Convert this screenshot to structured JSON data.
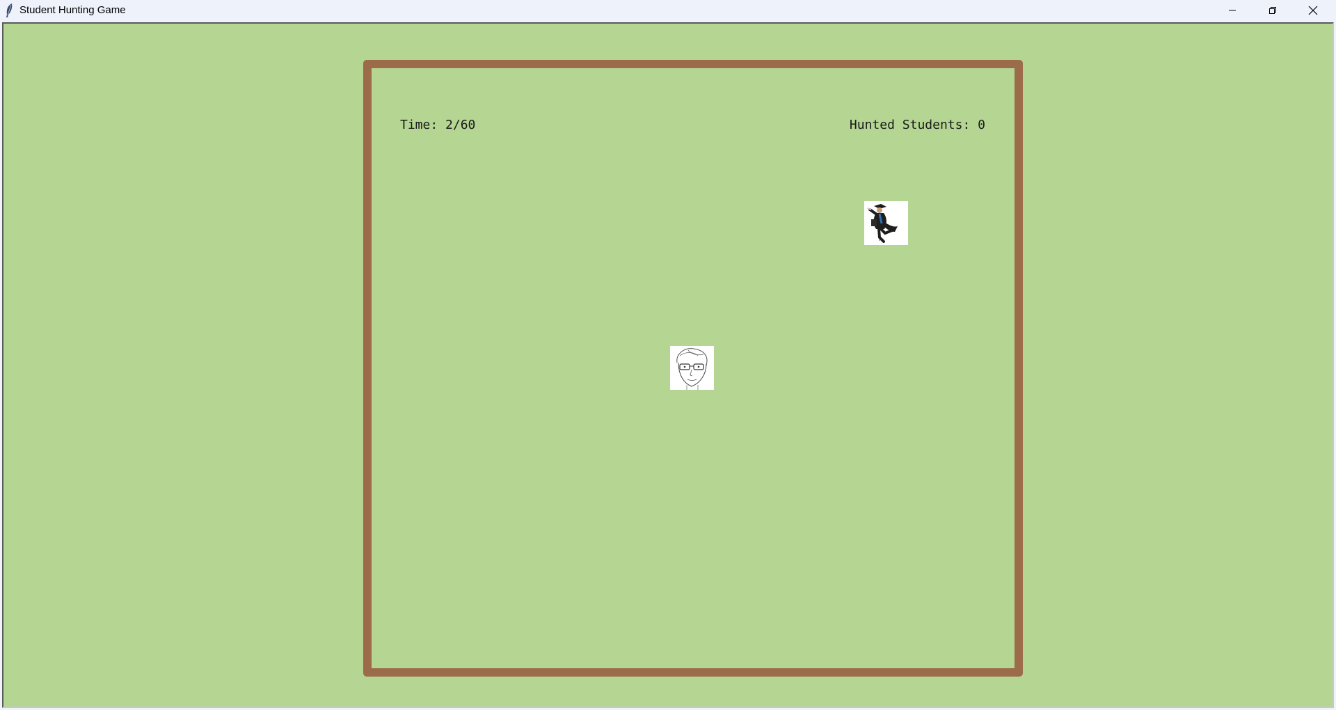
{
  "window": {
    "title": "Student Hunting Game",
    "controls": {
      "minimize_icon": "minimize-icon",
      "maximize_icon": "restore-icon",
      "close_icon": "close-icon"
    }
  },
  "game": {
    "time_text": "Time: 2/60",
    "time_elapsed": 2,
    "time_total": 60,
    "score_text": "Hunted Students: 0",
    "hunted_students": 0,
    "colors": {
      "background": "#b5d593",
      "arena_border": "#9b6b4a",
      "text": "#1a1a1a"
    },
    "sprites": {
      "student": "running-graduate-student",
      "hunter": "sketched-face-with-glasses"
    }
  }
}
